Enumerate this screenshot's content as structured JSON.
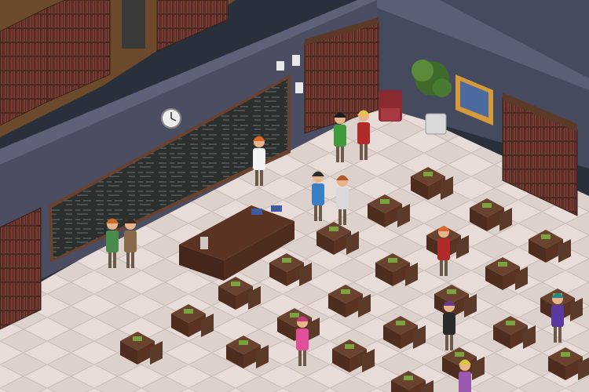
{
  "scene": {
    "type": "isometric-classroom",
    "palette": {
      "floor_light": "#e7dcd8",
      "floor_dark": "#d6cac5",
      "wall_side": "#4b4e62",
      "wall_top": "#5e6177",
      "chalkboard": "#2b2f2e",
      "wood": "#5b3a2a",
      "desk": "#6a4330",
      "book_green": "#7aa33e",
      "hallway": "#cfd3d9",
      "library_floor": "#6e4a2d"
    }
  },
  "room": {
    "chalkboard": {
      "name": "chalkboard"
    },
    "clock": {
      "name": "wall-clock"
    },
    "plant": {
      "name": "potted-plant"
    },
    "map": {
      "name": "wall-map"
    },
    "teacher_desk": {
      "name": "teacher-desk"
    }
  },
  "characters": [
    {
      "id": "teacher",
      "role": "teacher",
      "hair": "#d9682a",
      "outfit": "#f2f2f2",
      "at": "chalkboard"
    },
    {
      "id": "student-green-backpack",
      "role": "student",
      "hair": "#c86a2a",
      "outfit": "#4a8a4a",
      "at": "board-left"
    },
    {
      "id": "student-brown-backpack",
      "role": "student",
      "hair": "#3b2a20",
      "outfit": "#8a6a4a",
      "at": "board-left"
    },
    {
      "id": "student-green-hoodie",
      "role": "student",
      "hair": "#1c1c1c",
      "outfit": "#3f9a3a",
      "at": "bookshelf"
    },
    {
      "id": "student-blonde",
      "role": "student",
      "hair": "#e7c34a",
      "outfit": "#b02a2a",
      "at": "bookshelf"
    },
    {
      "id": "student-blue-jacket",
      "role": "student",
      "hair": "#2c2c2c",
      "outfit": "#3a7fc4",
      "at": "center"
    },
    {
      "id": "student-striped",
      "role": "student",
      "hair": "#b05a2a",
      "outfit": "#d9d9d9",
      "at": "center"
    },
    {
      "id": "student-seated-red",
      "role": "student",
      "hair": "#d9682a",
      "outfit": "#b02a2a",
      "at": "desk"
    },
    {
      "id": "student-pink",
      "role": "student",
      "hair": "#c43a7a",
      "outfit": "#e0509a",
      "at": "desk"
    },
    {
      "id": "student-orange-backpack",
      "role": "student",
      "hair": "#6a3a8a",
      "outfit": "#2a2a2a",
      "at": "desk"
    },
    {
      "id": "student-teal",
      "role": "student",
      "hair": "#2a8a8a",
      "outfit": "#5a3aa0",
      "at": "desk"
    },
    {
      "id": "student-yellow",
      "role": "student",
      "hair": "#d9c83a",
      "outfit": "#9a5ab0",
      "at": "desk"
    }
  ]
}
